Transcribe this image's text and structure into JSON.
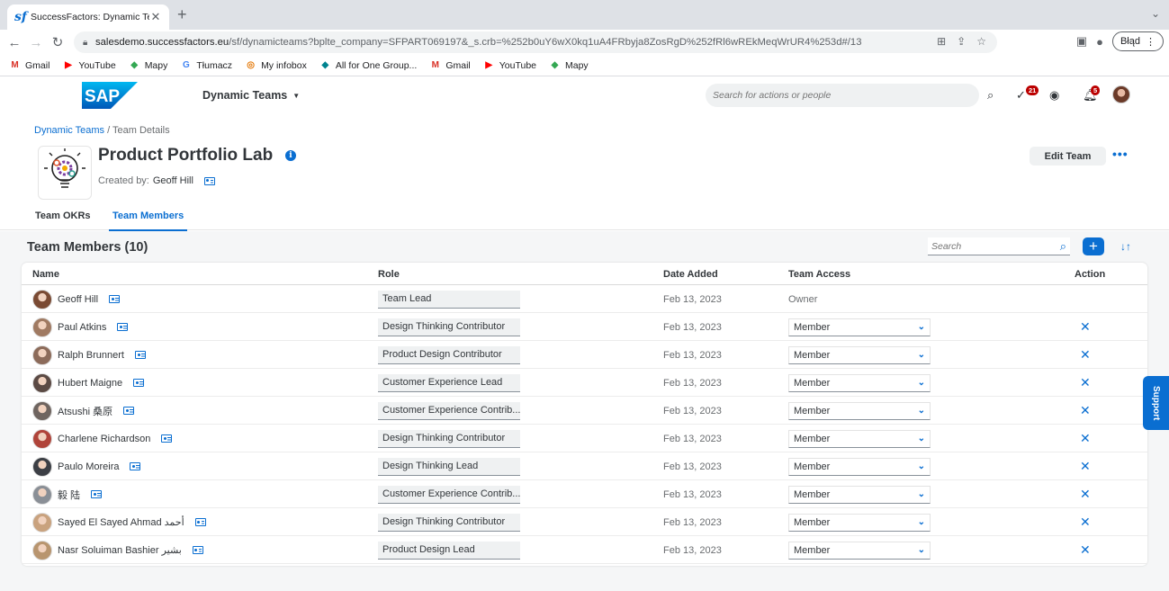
{
  "browser": {
    "tab_title": "SuccessFactors: Dynamic Tea",
    "tab_favicon": "sf",
    "url_host": "salesdemo.successfactors.eu",
    "url_path": "/sf/dynamicteams?bplte_company=SFPART069197&_s.crb=%252b0uY6wX0kq1uA4FRbyja8ZosRgD%252fRl6wREkMeqWrUR4%253d#/13",
    "profile_label": "Błąd",
    "bookmarks": [
      {
        "label": "Gmail",
        "icon": "gmail-icon",
        "glyph": "M",
        "color": "#d93025"
      },
      {
        "label": "YouTube",
        "icon": "youtube-icon",
        "glyph": "▶",
        "color": "#ff0000"
      },
      {
        "label": "Mapy",
        "icon": "maps-icon",
        "glyph": "◆",
        "color": "#34a853"
      },
      {
        "label": "Tłumacz",
        "icon": "translate-icon",
        "glyph": "G",
        "color": "#4285f4"
      },
      {
        "label": "My infobox",
        "icon": "infobox-icon",
        "glyph": "◎",
        "color": "#e37400"
      },
      {
        "label": "All for One Group...",
        "icon": "allforone-icon",
        "glyph": "◆",
        "color": "#00838f"
      },
      {
        "label": "Gmail",
        "icon": "gmail-icon",
        "glyph": "M",
        "color": "#d93025"
      },
      {
        "label": "YouTube",
        "icon": "youtube-icon",
        "glyph": "▶",
        "color": "#ff0000"
      },
      {
        "label": "Mapy",
        "icon": "maps-icon",
        "glyph": "◆",
        "color": "#34a853"
      }
    ]
  },
  "shell": {
    "logo_text": "SAP",
    "app_title": "Dynamic Teams",
    "search_placeholder": "Search for actions or people",
    "todo_badge": "21",
    "notif_badge": "5",
    "accent": "#0a6ed1"
  },
  "page": {
    "breadcrumb_link": "Dynamic Teams",
    "breadcrumb_sep": "/",
    "breadcrumb_current": "Team Details",
    "title": "Product Portfolio Lab",
    "created_by_label": "Created by:",
    "created_by_name": "Geoff Hill",
    "edit_button": "Edit Team",
    "more_button": "•••",
    "tabs": [
      "Team OKRs",
      "Team Members"
    ],
    "active_tab": "Team Members"
  },
  "members": {
    "title": "Team Members (10)",
    "search_placeholder": "Search",
    "columns": [
      "Name",
      "Role",
      "Date Added",
      "Team Access",
      "Action"
    ],
    "rows": [
      {
        "name": "Geoff Hill",
        "role": "Team Lead",
        "date": "Feb 13, 2023",
        "access": "Owner",
        "editable": false,
        "avatar": "#7a4a33"
      },
      {
        "name": "Paul Atkins",
        "role": "Design Thinking Contributor",
        "date": "Feb 13, 2023",
        "access": "Member",
        "editable": true,
        "avatar": "#a07a62"
      },
      {
        "name": "Ralph Brunnert",
        "role": "Product Design Contributor",
        "date": "Feb 13, 2023",
        "access": "Member",
        "editable": true,
        "avatar": "#8c6b5a"
      },
      {
        "name": "Hubert Maigne",
        "role": "Customer Experience Lead",
        "date": "Feb 13, 2023",
        "access": "Member",
        "editable": true,
        "avatar": "#5b4a44"
      },
      {
        "name": "Atsushi 桑原",
        "role": "Customer Experience Contrib...",
        "date": "Feb 13, 2023",
        "access": "Member",
        "editable": true,
        "avatar": "#6f6560"
      },
      {
        "name": "Charlene Richardson",
        "role": "Design Thinking Contributor",
        "date": "Feb 13, 2023",
        "access": "Member",
        "editable": true,
        "avatar": "#b0443a"
      },
      {
        "name": "Paulo Moreira",
        "role": "Design Thinking Lead",
        "date": "Feb 13, 2023",
        "access": "Member",
        "editable": true,
        "avatar": "#3c3f45"
      },
      {
        "name": "毅 陆",
        "role": "Customer Experience Contrib...",
        "date": "Feb 13, 2023",
        "access": "Member",
        "editable": true,
        "avatar": "#8a8f96"
      },
      {
        "name": "Sayed El Sayed Ahmad أحمد",
        "role": "Design Thinking Contributor",
        "date": "Feb 13, 2023",
        "access": "Member",
        "editable": true,
        "avatar": "#c9a27e"
      },
      {
        "name": "Nasr Soluiman Bashier بشير",
        "role": "Product Design Lead",
        "date": "Feb 13, 2023",
        "access": "Member",
        "editable": true,
        "avatar": "#b8956f"
      }
    ]
  },
  "support_label": "Support"
}
